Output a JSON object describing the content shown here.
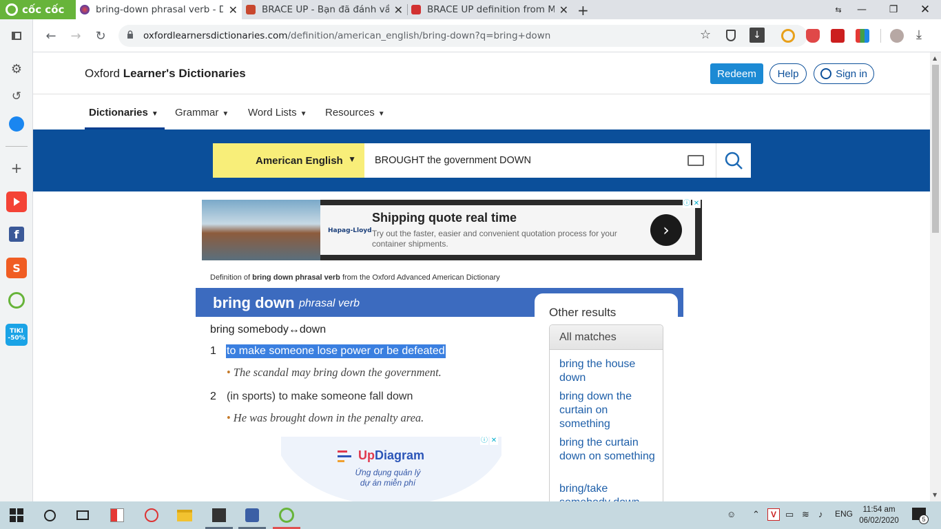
{
  "browser": {
    "brand": "cốc cốc",
    "tabs": [
      {
        "title": "bring-down phrasal verb - De",
        "active": true
      },
      {
        "title": "BRACE UP - Bạn đã đánh vần",
        "active": false
      },
      {
        "title": "BRACE UP definition from Ma",
        "active": false
      }
    ],
    "url_host": "oxfordlearnersdictionaries.com",
    "url_path": "/definition/american_english/bring-down?q=bring+down"
  },
  "sidebar": {
    "badge": "TIKI -50%",
    "items": [
      "panel-icon",
      "settings-icon",
      "history-icon",
      "messenger-icon",
      "add-icon",
      "youtube-icon",
      "facebook-icon",
      "shopee-icon",
      "coccoc-icon",
      "tiki-icon"
    ]
  },
  "site": {
    "logo_plain": "Oxford ",
    "logo_bold": "Learner's Dictionaries",
    "redeem": "Redeem",
    "help": "Help",
    "signin": "Sign in",
    "nav": [
      {
        "label": "Dictionaries",
        "active": true
      },
      {
        "label": "Grammar",
        "active": false
      },
      {
        "label": "Word Lists",
        "active": false
      },
      {
        "label": "Resources",
        "active": false
      }
    ],
    "dictionary_select": "American English",
    "search_value": "BROUGHT the government DOWN"
  },
  "ad1": {
    "brand": "Hapag-Lloyd",
    "title": "Shipping quote real time",
    "subtitle": "Try out the faster, easier and convenient quotation process for your container shipments."
  },
  "entry": {
    "source_prefix": "Definition of ",
    "source_bold": "bring down phrasal verb",
    "source_suffix": " from the Oxford Advanced American Dictionary",
    "headword": "bring down",
    "pos": "phrasal verb",
    "pattern": "bring somebody↔down",
    "senses": [
      {
        "num": "1",
        "definition": "to make someone lose power or be defeated",
        "example": "The scandal may bring down the government.",
        "highlighted": true
      },
      {
        "num": "2",
        "definition": "(in sports) to make someone fall down",
        "example": "He was brought down in the penalty area.",
        "highlighted": false
      }
    ]
  },
  "other_results": {
    "title": "Other results",
    "tab": "All matches",
    "links": [
      "bring the house down",
      "bring down the curtain on something",
      "bring the curtain down on something",
      "bring/take somebody down"
    ]
  },
  "ad2": {
    "title_prefix": "Up",
    "title_suffix": "Diagram",
    "subtitle_line1": "Ứng dụng quản lý",
    "subtitle_line2": "dự án miễn phí"
  },
  "taskbar": {
    "language": "ENG",
    "time": "11:54 am",
    "date": "06/02/2020",
    "notifications": "5"
  }
}
